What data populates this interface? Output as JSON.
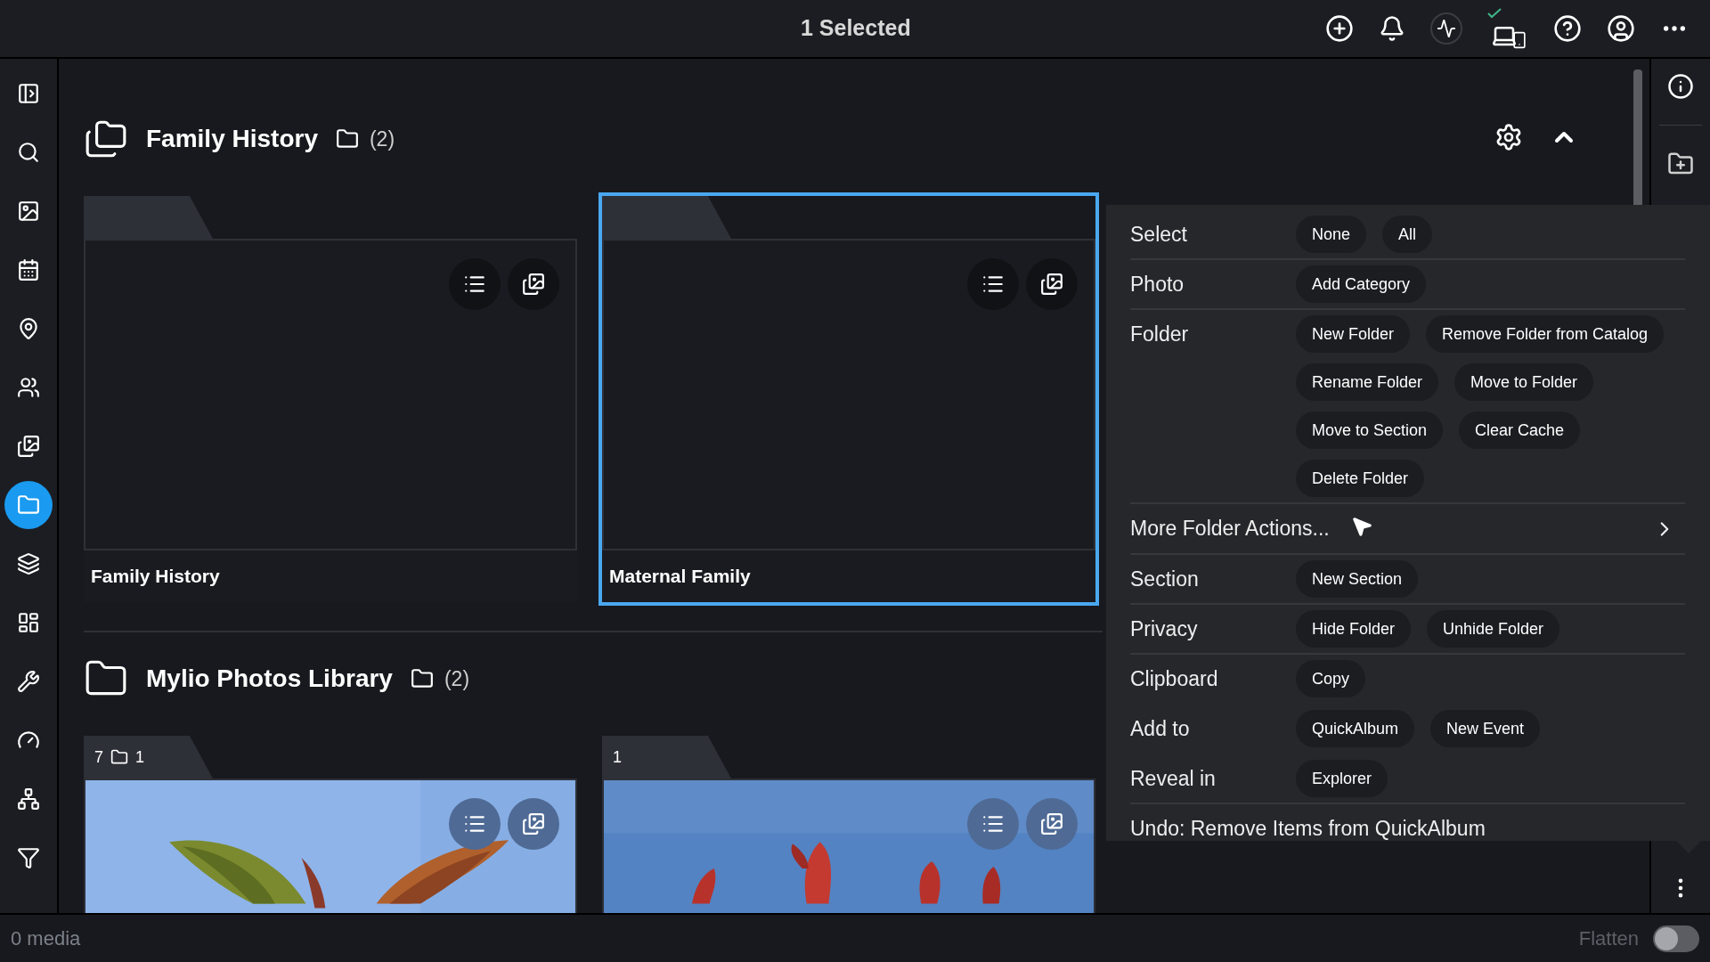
{
  "title": "1 Selected",
  "sidebar": {
    "items": [
      {
        "selected": false
      },
      {
        "selected": false
      },
      {
        "selected": false
      },
      {
        "selected": false
      },
      {
        "selected": false
      },
      {
        "selected": false
      },
      {
        "selected": false
      },
      {
        "selected": true
      },
      {
        "selected": false
      },
      {
        "selected": false
      },
      {
        "selected": false
      },
      {
        "selected": false
      },
      {
        "selected": false
      },
      {
        "selected": false
      }
    ]
  },
  "sections": [
    {
      "title": "Family History",
      "count": "(2)",
      "cards": [
        {
          "kind": "empty",
          "name": "Family History",
          "selected": false
        },
        {
          "kind": "empty",
          "name": "Maternal Family",
          "selected": true
        }
      ]
    },
    {
      "title": "Mylio Photos Library",
      "count": "(2)",
      "cards": [
        {
          "kind": "picture",
          "media_count": "7",
          "folder_count": "1",
          "selected": false
        },
        {
          "kind": "picture",
          "media_count": "1",
          "selected": false
        }
      ]
    }
  ],
  "menu": {
    "rows": [
      {
        "kind": "actions",
        "label": "Select",
        "actions": [
          "None",
          "All"
        ],
        "separator_after": true
      },
      {
        "kind": "actions",
        "label": "Photo",
        "actions": [
          "Add Category"
        ],
        "separator_after": true
      },
      {
        "kind": "actions",
        "label": "Folder",
        "actions": [
          "New Folder",
          "Remove Folder from Catalog",
          "Rename Folder",
          "Move to Folder",
          "Move to Section",
          "Clear Cache",
          "Delete Folder"
        ],
        "separator_after": true
      },
      {
        "kind": "submenu",
        "label": "More Folder Actions...",
        "separator_after": true
      },
      {
        "kind": "actions",
        "label": "Section",
        "actions": [
          "New Section"
        ],
        "separator_after": true
      },
      {
        "kind": "actions",
        "label": "Privacy",
        "actions": [
          "Hide Folder",
          "Unhide Folder"
        ],
        "separator_after": true
      },
      {
        "kind": "actions",
        "label": "Clipboard",
        "actions": [
          "Copy"
        ],
        "separator_after": false
      },
      {
        "kind": "actions",
        "label": "Add to",
        "actions": [
          "QuickAlbum",
          "New Event"
        ],
        "separator_after": false
      },
      {
        "kind": "actions",
        "label": "Reveal in",
        "actions": [
          "Explorer"
        ],
        "separator_after": true
      },
      {
        "kind": "command",
        "label": "Undo: Remove Items from QuickAlbum",
        "separator_after": false
      }
    ]
  },
  "status_bar": {
    "media": "0 media",
    "flatten": {
      "label": "Flatten",
      "on": false,
      "disabled": true
    }
  }
}
